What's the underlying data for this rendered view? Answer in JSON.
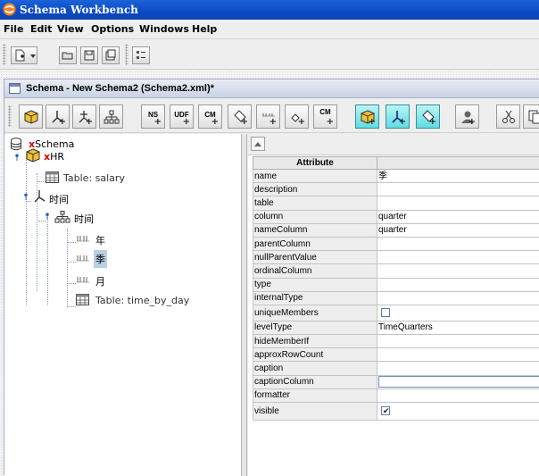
{
  "window": {
    "title": "Schema Workbench"
  },
  "menu": [
    {
      "label": "File"
    },
    {
      "label": "Edit"
    },
    {
      "label": "View"
    },
    {
      "label": "Options"
    },
    {
      "label": "Windows"
    },
    {
      "label": "Help"
    }
  ],
  "main_toolbar": {
    "buttons": [
      "new-file-icon",
      "dropdown-arrow-icon",
      "open-folder-icon",
      "save-icon",
      "save-as-icon",
      "preferences-icon"
    ]
  },
  "document": {
    "title": "Schema - New Schema2 (Schema2.xml)*"
  },
  "schema_toolbar": {
    "buttons": [
      {
        "icon": "add-cube-icon",
        "label": ""
      },
      {
        "icon": "add-dimension-icon",
        "label": ""
      },
      {
        "icon": "add-dimension-usage-icon",
        "label": ""
      },
      {
        "icon": "add-hierarchy-icon",
        "label": ""
      },
      {
        "icon": "add-named-set-icon",
        "label": "NS"
      },
      {
        "icon": "add-udf-icon",
        "label": "UDF"
      },
      {
        "icon": "add-calculated-member-icon",
        "label": "CM"
      },
      {
        "icon": "add-measure-icon",
        "label": ""
      },
      {
        "icon": "add-level-icon",
        "label": ""
      },
      {
        "icon": "add-property-icon",
        "label": ""
      },
      {
        "icon": "add-calculated-member-2-icon",
        "label": "CM"
      },
      {
        "icon": "add-virtual-cube-icon",
        "label": ""
      },
      {
        "icon": "add-virtual-dimension-icon",
        "label": ""
      },
      {
        "icon": "add-virtual-measure-icon",
        "label": ""
      },
      {
        "icon": "add-role-icon",
        "label": ""
      },
      {
        "icon": "cut-icon",
        "label": ""
      },
      {
        "icon": "copy-icon",
        "label": ""
      }
    ]
  },
  "tree": {
    "root": "Schema",
    "cube": "HR",
    "table_salary": "Table: salary",
    "dimension": "时间",
    "hierarchy": "时间",
    "levels": [
      "年",
      "季",
      "月"
    ],
    "table_time": "Table: time_by_day"
  },
  "properties": {
    "header": "Attribute",
    "rows": [
      {
        "name": "name",
        "value": "季"
      },
      {
        "name": "description",
        "value": ""
      },
      {
        "name": "table",
        "value": ""
      },
      {
        "name": "column",
        "value": "quarter"
      },
      {
        "name": "nameColumn",
        "value": "quarter"
      },
      {
        "name": "parentColumn",
        "value": ""
      },
      {
        "name": "nullParentValue",
        "value": ""
      },
      {
        "name": "ordinalColumn",
        "value": ""
      },
      {
        "name": "type",
        "value": ""
      },
      {
        "name": "internalType",
        "value": ""
      },
      {
        "name": "uniqueMembers",
        "value": "",
        "checkbox": false
      },
      {
        "name": "levelType",
        "value": "TimeQuarters"
      },
      {
        "name": "hideMemberIf",
        "value": ""
      },
      {
        "name": "approxRowCount",
        "value": ""
      },
      {
        "name": "caption",
        "value": ""
      },
      {
        "name": "captionColumn",
        "value": "",
        "editing": true
      },
      {
        "name": "formatter",
        "value": ""
      },
      {
        "name": "visible",
        "value": "",
        "checkbox": true
      }
    ]
  },
  "colors": {
    "title_bar": "#0a4ac4",
    "selection": "#b8cfe5",
    "red_marker": "#e00000",
    "toolbar_selected": "#5fdde2"
  }
}
